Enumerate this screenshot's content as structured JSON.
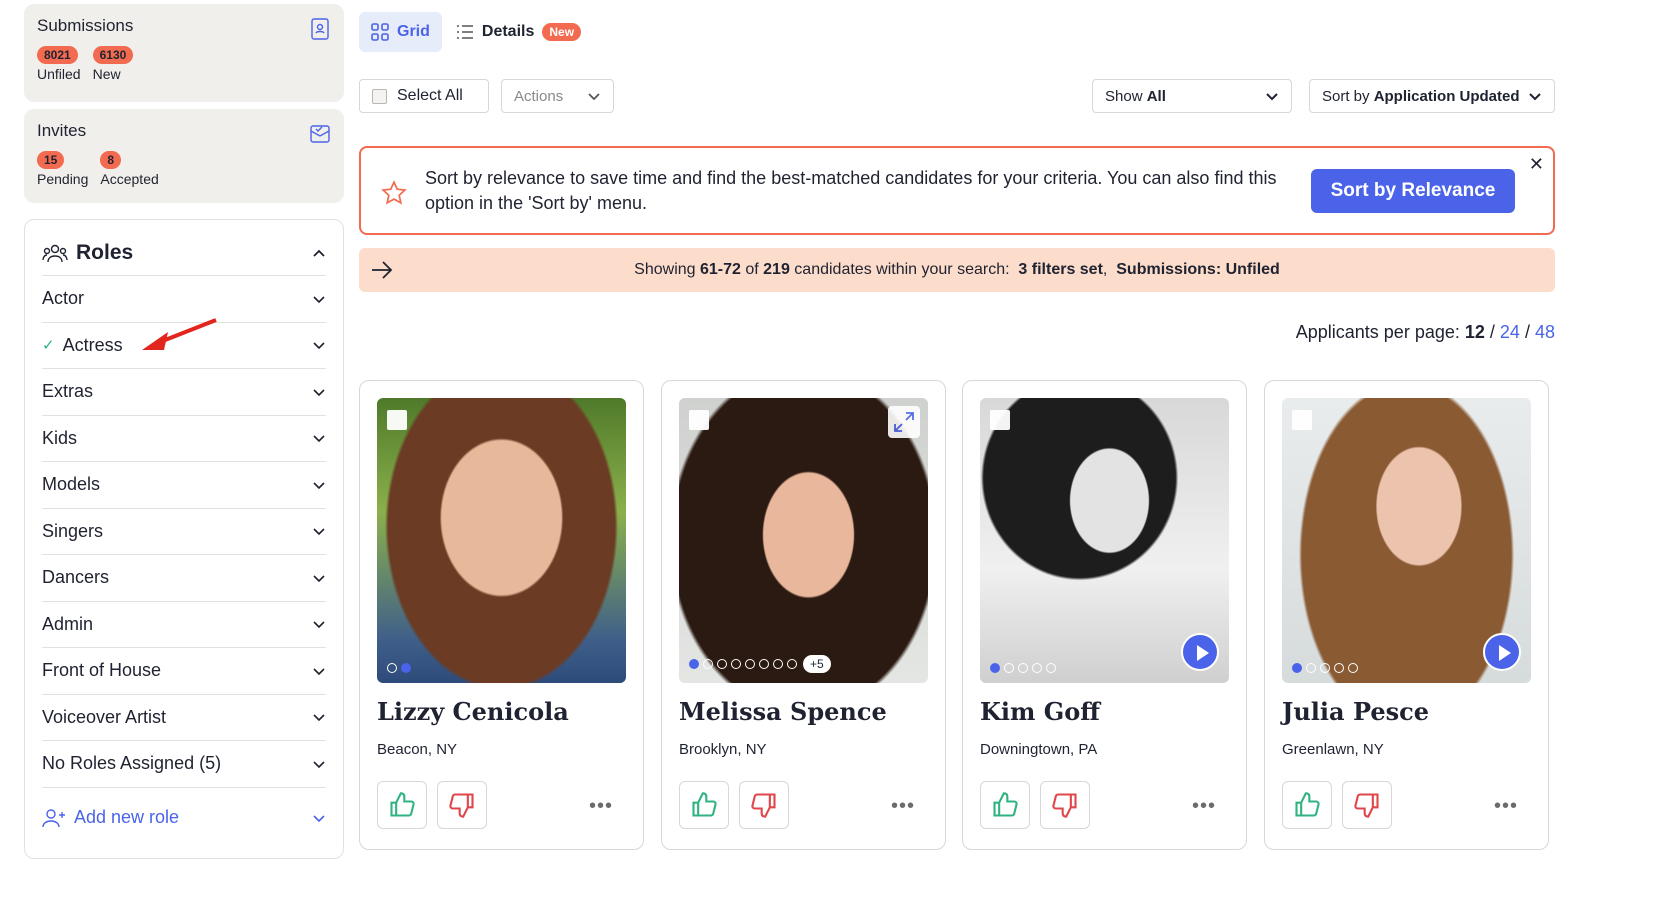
{
  "sidebar": {
    "submissions": {
      "title": "Submissions",
      "unfiled_count": "8021",
      "unfiled_label": "Unfiled",
      "new_count": "6130",
      "new_label": "New"
    },
    "invites": {
      "title": "Invites",
      "pending_count": "15",
      "pending_label": "Pending",
      "accepted_count": "8",
      "accepted_label": "Accepted"
    },
    "roles": {
      "title": "Roles",
      "items": [
        {
          "label": "Actor",
          "checked": false
        },
        {
          "label": "Actress",
          "checked": true
        },
        {
          "label": "Extras",
          "checked": false
        },
        {
          "label": "Kids",
          "checked": false
        },
        {
          "label": "Models",
          "checked": false
        },
        {
          "label": "Singers",
          "checked": false
        },
        {
          "label": "Dancers",
          "checked": false
        },
        {
          "label": "Admin",
          "checked": false
        },
        {
          "label": "Front of House",
          "checked": false
        },
        {
          "label": "Voiceover Artist",
          "checked": false
        },
        {
          "label": "No Roles Assigned (5)",
          "checked": false
        }
      ],
      "add_label": "Add new role"
    }
  },
  "tabs": {
    "grid": "Grid",
    "details": "Details",
    "details_badge": "New"
  },
  "toolbar": {
    "select_all": "Select All",
    "actions": "Actions",
    "show_prefix": "Show ",
    "show_value": "All",
    "sort_prefix": "Sort by ",
    "sort_value": "Application Updated"
  },
  "banner": {
    "message": "Sort by relevance to save time and find the best-matched candidates for your criteria. You can also find this option in the 'Sort by' menu.",
    "cta": "Sort by Relevance",
    "close": "✕"
  },
  "results": {
    "prefix": "Showing ",
    "range": "61-72",
    "of": " of ",
    "total": "219",
    "suffix": " candidates within your search:  ",
    "filters": "3 filters set",
    "sep": ",  ",
    "submissions": "Submissions: Unfiled"
  },
  "per_page": {
    "label": "Applicants per page: ",
    "current": "12",
    "sep1": " / ",
    "opt1": "24",
    "sep2": " / ",
    "opt2": "48"
  },
  "candidates": [
    {
      "name": "Lizzy Cenicola",
      "location": "Beacon, NY",
      "photo_count_extra": ""
    },
    {
      "name": "Melissa Spence",
      "location": "Brooklyn, NY",
      "photo_count_extra": "+5"
    },
    {
      "name": "Kim Goff",
      "location": "Downingtown, PA",
      "photo_count_extra": ""
    },
    {
      "name": "Julia Pesce",
      "location": "Greenlawn, NY",
      "photo_count_extra": ""
    }
  ],
  "colors": {
    "accent": "#4b63e8",
    "badge": "#f26a4f",
    "info_bg": "#fcdccb",
    "thumb_up": "#2fb380",
    "thumb_down": "#e0454a"
  }
}
